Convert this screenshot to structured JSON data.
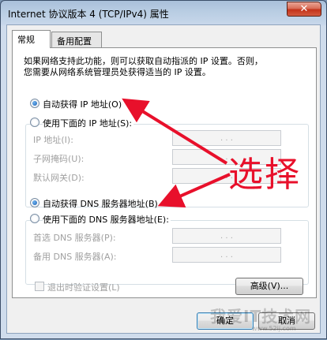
{
  "window": {
    "title": "Internet 协议版本 4 (TCP/IPv4) 属性",
    "close_label": "✕"
  },
  "tabs": [
    {
      "label": "常规",
      "active": true
    },
    {
      "label": "备用配置",
      "active": false
    }
  ],
  "description": {
    "line1": "如果网络支持此功能，则可以获取自动指派的 IP 设置。否则，",
    "line2": "您需要从网络系统管理员处获得适当的 IP 设置。"
  },
  "ip_section": {
    "auto_label": "自动获得 IP 地址(O)",
    "manual_label": "使用下面的 IP 地址(S):",
    "selected": "auto",
    "fields": [
      {
        "label": "IP 地址(I):",
        "value": ".   .   ."
      },
      {
        "label": "子网掩码(U):",
        "value": ".   .   ."
      },
      {
        "label": "默认网关(D):",
        "value": ".   .   ."
      }
    ]
  },
  "dns_section": {
    "auto_label": "自动获得 DNS 服务器地址(B)",
    "manual_label": "使用下面的 DNS 服务器地址(E):",
    "selected": "auto",
    "fields": [
      {
        "label": "首选 DNS 服务器(P):",
        "value": ".   .   ."
      },
      {
        "label": "备用 DNS 服务器(A):",
        "value": ".   .   ."
      }
    ]
  },
  "validate_on_exit": {
    "label": "退出时验证设置(L)",
    "checked": false
  },
  "buttons": {
    "advanced": "高级(V)...",
    "ok": "确定",
    "cancel": "取消"
  },
  "annotation": {
    "text": "选择",
    "color": "#e8102b"
  },
  "watermark": {
    "text": "我爱IT技术网",
    "sub": "www.52ij.com"
  }
}
